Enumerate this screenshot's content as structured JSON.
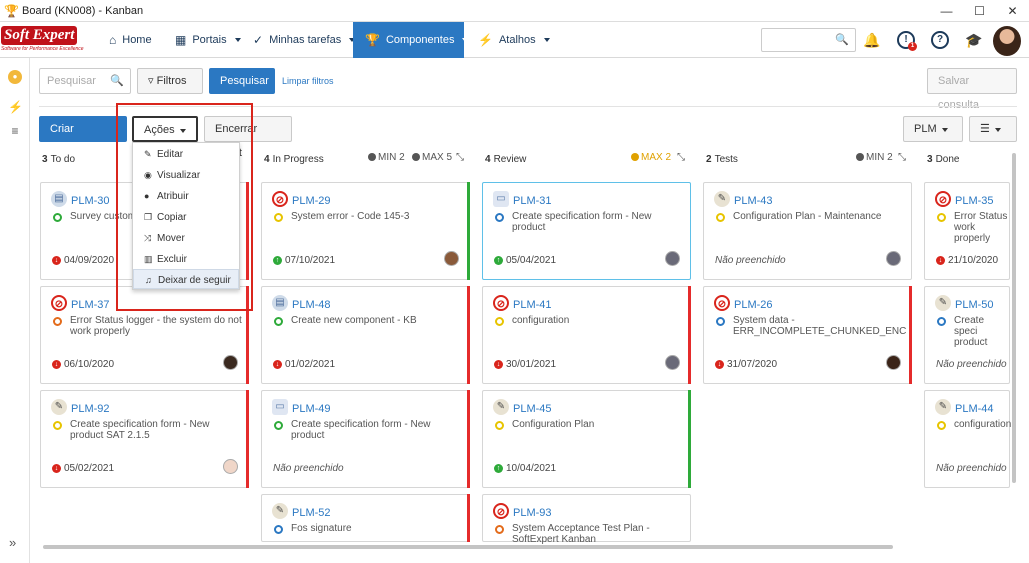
{
  "window": {
    "title": "Board (KN008) - Kanban"
  },
  "nav": {
    "logo_main": "Soft Expert",
    "logo_tag": "Software for Performance Excellence",
    "items": [
      {
        "label": "Home"
      },
      {
        "label": "Portais"
      },
      {
        "label": "Minhas tarefas"
      },
      {
        "label": "Componentes"
      },
      {
        "label": "Atalhos"
      }
    ],
    "notification_badge": "1"
  },
  "filters": {
    "search_placeholder": "Pesquisar",
    "filters_label": "Filtros",
    "search_button": "Pesquisar",
    "clear_link": "Limpar filtros",
    "save_query": "Salvar consulta"
  },
  "toolbar": {
    "create": "Criar atividade",
    "actions": "Ações",
    "end_sprint": "Encerrar sprint",
    "plm": "PLM"
  },
  "menu": [
    {
      "label": "Editar",
      "icon": "pencil-icon"
    },
    {
      "label": "Visualizar",
      "icon": "eye-icon"
    },
    {
      "label": "Atribuir",
      "icon": "user-icon"
    },
    {
      "label": "Copiar",
      "icon": "copy-icon"
    },
    {
      "label": "Mover",
      "icon": "shuffle-icon"
    },
    {
      "label": "Excluir",
      "icon": "trash-icon"
    },
    {
      "label": "Deixar de seguir",
      "icon": "bell-icon"
    }
  ],
  "columns": [
    {
      "count": "3",
      "name": "To do"
    },
    {
      "count": "4",
      "name": "In Progress",
      "min": "MIN 2",
      "max": "MAX 5"
    },
    {
      "count": "4",
      "name": "Review",
      "max": "MAX 2"
    },
    {
      "count": "2",
      "name": "Tests",
      "min": "MIN 2"
    },
    {
      "count": "3",
      "name": "Done"
    }
  ],
  "cards": {
    "c1": {
      "id": "PLM-30",
      "text": "Survey customer",
      "date": "04/09/2020"
    },
    "c2": {
      "id": "PLM-37",
      "text": "Error Status logger - the system do not work properly",
      "date": "06/10/2020"
    },
    "c3": {
      "id": "PLM-92",
      "text": "Create specification form - New product SAT 2.1.5",
      "date": "05/02/2021"
    },
    "c4": {
      "id": "PLM-29",
      "text": "System error - Code 145-3",
      "date": "07/10/2021"
    },
    "c5": {
      "id": "PLM-48",
      "text": "Create new component - KB",
      "date": "01/02/2021"
    },
    "c6": {
      "id": "PLM-49",
      "text": "Create specification form - New product",
      "date": "Não preenchido"
    },
    "c7": {
      "id": "PLM-52",
      "text": "Fos signature",
      "date": ""
    },
    "c8": {
      "id": "PLM-31",
      "text": "Create specification form - New product",
      "date": "05/04/2021"
    },
    "c9": {
      "id": "PLM-41",
      "text": "configuration",
      "date": "30/01/2021"
    },
    "c10": {
      "id": "PLM-45",
      "text": "Configuration Plan",
      "date": "10/04/2021"
    },
    "c11": {
      "id": "PLM-93",
      "text": "System Acceptance Test Plan - SoftExpert Kanban",
      "date": ""
    },
    "c12": {
      "id": "PLM-43",
      "text": "Configuration Plan - Maintenance",
      "date": "Não preenchido"
    },
    "c13": {
      "id": "PLM-26",
      "text": "System data - ERR_INCOMPLETE_CHUNKED_ENC",
      "date": "31/07/2020"
    },
    "c14": {
      "id": "PLM-35",
      "text": "Error Status work properly",
      "date": "21/10/2020"
    },
    "c15": {
      "id": "PLM-50",
      "text": "Create speci product",
      "date": "Não preenchido"
    },
    "c16": {
      "id": "PLM-44",
      "text": "configuration",
      "date": "Não preenchido"
    }
  }
}
